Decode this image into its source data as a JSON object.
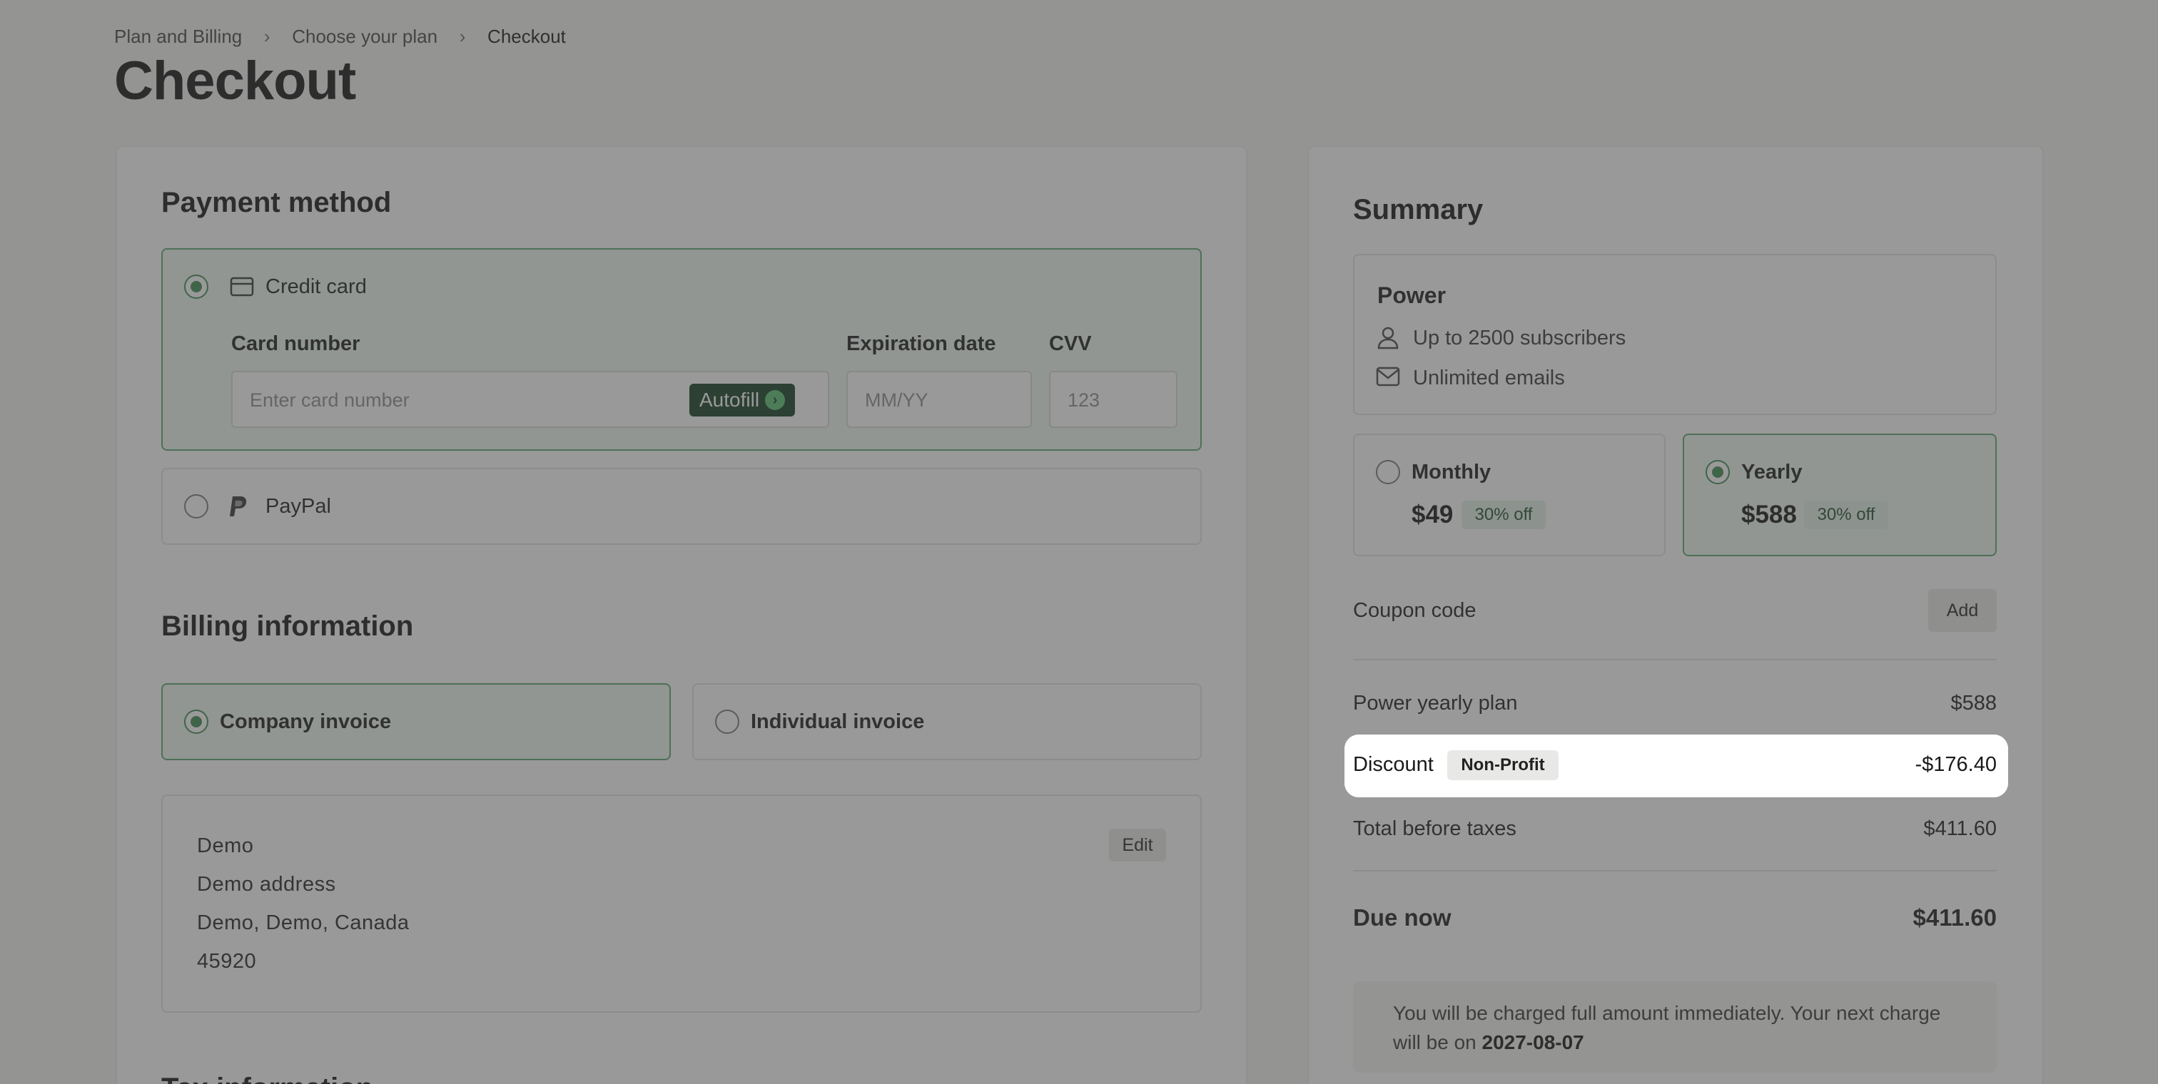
{
  "breadcrumb": [
    "Plan and Billing",
    "Choose your plan",
    "Checkout"
  ],
  "page_title": "Checkout",
  "payment": {
    "heading": "Payment method",
    "credit_card_label": "Credit card",
    "card_number_label": "Card number",
    "card_number_placeholder": "Enter card number",
    "autofill_label": "Autofill",
    "expiration_label": "Expiration date",
    "expiration_placeholder": "MM/YY",
    "cvv_label": "CVV",
    "cvv_placeholder": "123",
    "paypal_label": "PayPal"
  },
  "billing": {
    "heading": "Billing information",
    "company_label": "Company invoice",
    "individual_label": "Individual invoice",
    "address_lines": [
      "Demo",
      "Demo address",
      "Demo, Demo, Canada",
      "45920"
    ],
    "edit_label": "Edit",
    "next_heading": "Tax information"
  },
  "summary": {
    "heading": "Summary",
    "plan_name": "Power",
    "features": [
      "Up to 2500 subscribers",
      "Unlimited emails"
    ],
    "monthly": {
      "label": "Monthly",
      "price": "$49",
      "badge": "30% off"
    },
    "yearly": {
      "label": "Yearly",
      "price": "$588",
      "badge": "30% off"
    },
    "coupon_label": "Coupon code",
    "coupon_button": "Add",
    "lines": [
      {
        "label": "Power yearly plan",
        "value": "$588"
      },
      {
        "label": "Discount",
        "badge": "Non-Profit",
        "value": "-$176.40"
      },
      {
        "label": "Total before taxes",
        "value": "$411.60"
      }
    ],
    "due_label": "Due now",
    "due_value": "$411.60",
    "notice_text": "You will be charged full amount immediately. Your next charge will be on",
    "notice_date": "2027-08-07"
  },
  "colors": {
    "accent": "#3b8a4f",
    "selected_bg": "#eef8f0",
    "overlay": "rgba(70,70,70,0.55)"
  }
}
